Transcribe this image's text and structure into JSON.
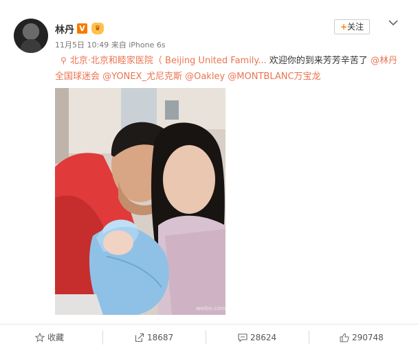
{
  "post": {
    "author": "林丹",
    "verified": "V",
    "vip_icon": "vip-crown-icon",
    "date": "11月5日",
    "time": "10:49",
    "source_prefix": "来自",
    "source": "iPhone 6s",
    "follow_plus": "+",
    "follow_label": "关注",
    "location": "北京·北京和睦家医院（ Beijing United Family...",
    "message": " 欢迎你的到来芳芳辛苦了",
    "mention1": "@林丹全国球迷会",
    "mention2": "@YONEX_尤尼克斯",
    "mention3": "@Oakley",
    "mention4": "@MONTBLANC万宝龙",
    "watermark": "weibo.com/lindan"
  },
  "actions": {
    "favorite_label": "收藏",
    "repost_count": "18687",
    "comment_count": "28624",
    "like_count": "290748"
  },
  "colors": {
    "accent": "#eb7350",
    "orange": "#ff8200"
  }
}
